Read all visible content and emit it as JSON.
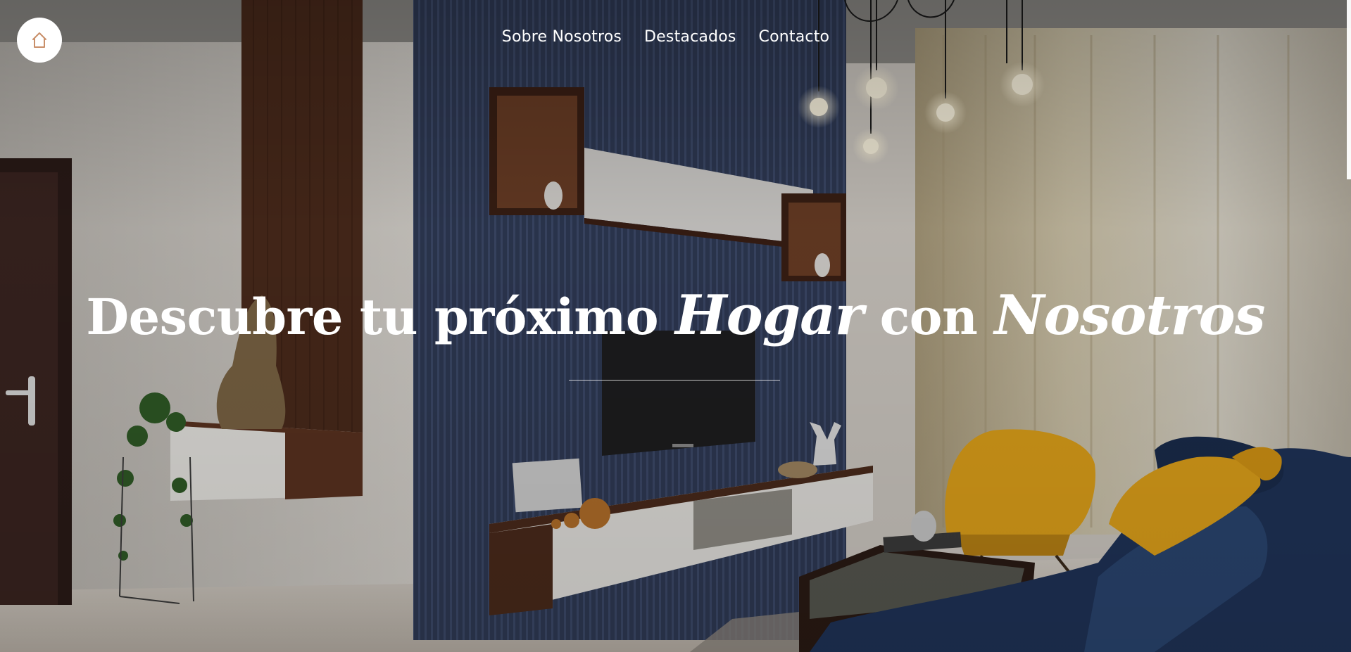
{
  "logo": {
    "icon": "home-icon",
    "accent_color": "#c98f6a"
  },
  "nav": {
    "items": [
      {
        "label": "Sobre Nosotros"
      },
      {
        "label": "Destacados"
      },
      {
        "label": "Contacto"
      }
    ]
  },
  "hero": {
    "title_part1": "Descubre tu próximo ",
    "title_script1": "Hogar",
    "title_part2": " con ",
    "title_script2": "Nosotros"
  },
  "colors": {
    "text": "#ffffff",
    "accent_wall": "#2f3a55",
    "armchair": "#e0a21a",
    "sofa": "#1f3358",
    "walnut": "#4a2a1b"
  }
}
